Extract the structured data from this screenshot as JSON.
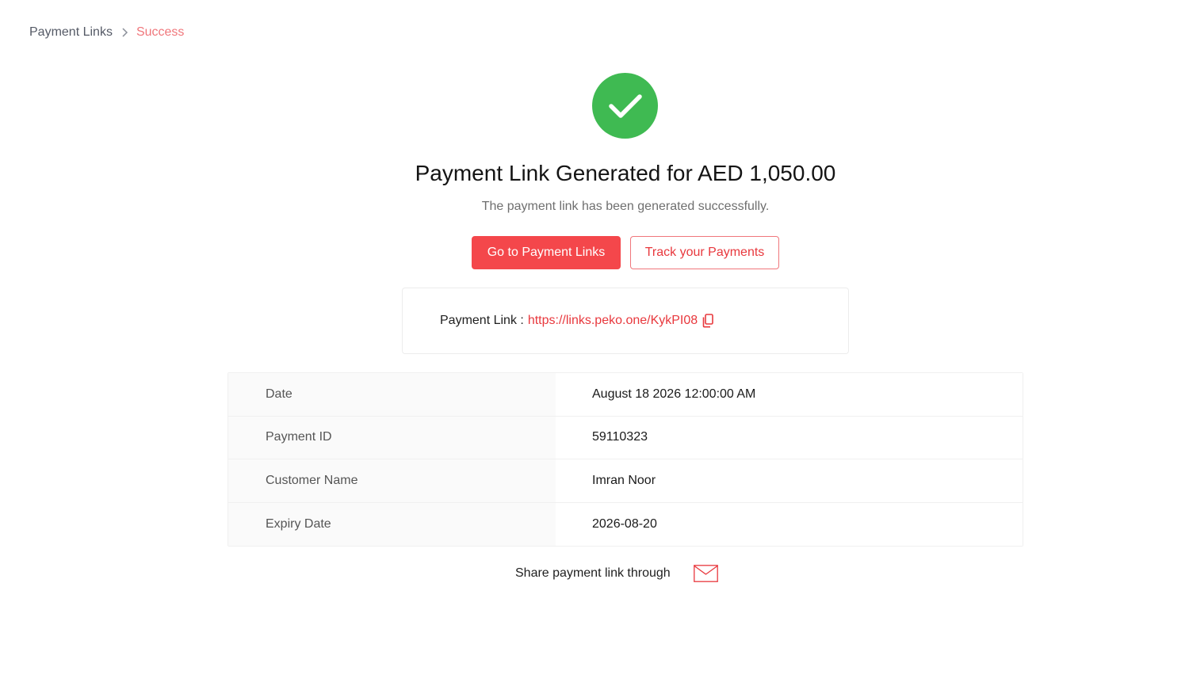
{
  "breadcrumb": {
    "root": "Payment Links",
    "current": "Success"
  },
  "success": {
    "title": "Payment Link Generated for AED 1,050.00",
    "subtitle": "The payment link has been generated successfully."
  },
  "actions": {
    "primary_label": "Go to Payment Links",
    "secondary_label": "Track your Payments"
  },
  "payment_link": {
    "label": "Payment Link :",
    "url": "https://links.peko.one/KykPI08"
  },
  "details": {
    "rows": [
      {
        "label": "Date",
        "value": "August 18 2026 12:00:00 AM"
      },
      {
        "label": "Payment ID",
        "value": "59110323"
      },
      {
        "label": "Customer Name",
        "value": "Imran Noor"
      },
      {
        "label": "Expiry Date",
        "value": "2026-08-20"
      }
    ]
  },
  "share": {
    "label": "Share payment link through"
  },
  "colors": {
    "accent": "#f4474b",
    "accent_text": "#e8383d",
    "success": "#3fba52",
    "breadcrumb_current": "#f0777c"
  },
  "icons": {
    "success": "check-circle-icon",
    "breadcrumb_separator": "chevron-right-icon",
    "copy": "copy-icon",
    "share": "mail-icon"
  }
}
